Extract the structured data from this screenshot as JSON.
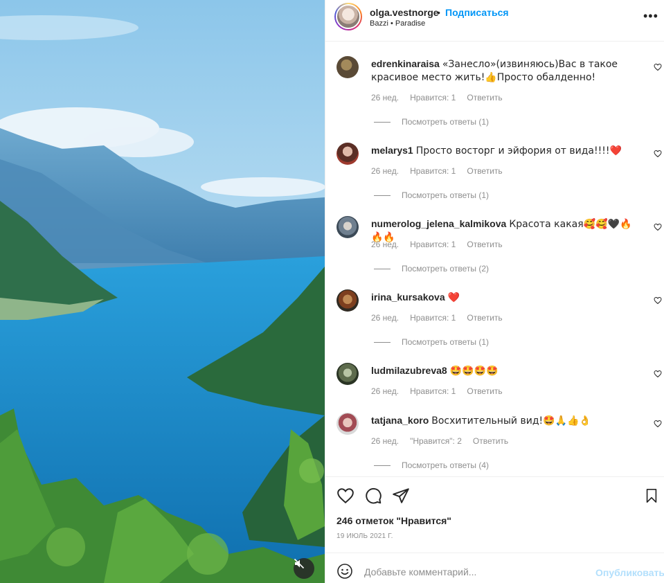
{
  "post": {
    "username": "olga.vestnorge",
    "separator": "•",
    "follow_label": "Подписаться",
    "subtitle": "Bazzi • Paradise",
    "more_icon": "more-horizontal-icon"
  },
  "comments": [
    {
      "user": "edrenkinaraisa",
      "text": "«Занесло»(извиняюсь)Вас в такое красивое место жить!👍Просто обалденно!",
      "age": "26 нед.",
      "likes": "Нравится: 1",
      "reply": "Ответить",
      "view_replies": "Посмотреть ответы (1)"
    },
    {
      "user": "melarys1",
      "text": "Просто восторг и эйфория от вида!!!!❤️",
      "age": "26 нед.",
      "likes": "Нравится: 1",
      "reply": "Ответить",
      "view_replies": "Посмотреть ответы (1)"
    },
    {
      "user": "numerolog_jelena_kalmikova",
      "text": "Красота какая🥰🥰🖤🔥🔥🔥",
      "age": "26 нед.",
      "likes": "Нравится: 1",
      "reply": "Ответить",
      "view_replies": "Посмотреть ответы (2)"
    },
    {
      "user": "irina_kursakova",
      "text": "❤️",
      "age": "26 нед.",
      "likes": "Нравится: 1",
      "reply": "Ответить",
      "view_replies": "Посмотреть ответы (1)"
    },
    {
      "user": "ludmilazubreva8",
      "text": "🤩🤩🤩🤩",
      "age": "26 нед.",
      "likes": "Нравится: 1",
      "reply": "Ответить",
      "view_replies": ""
    },
    {
      "user": "tatjana_koro",
      "text": "Восхитительный вид!🤩🙏👍👌",
      "age": "26 нед.",
      "likes": "\"Нравится\": 2",
      "reply": "Ответить",
      "view_replies": "Посмотреть ответы (4)"
    }
  ],
  "actions": {
    "likes_count": "246 отметок \"Нравится\"",
    "date": "19 ИЮЛЬ 2021 Г."
  },
  "composer": {
    "placeholder": "Добавьте комментарий...",
    "post_label": "Опубликовать"
  },
  "colors": {
    "accent": "#0095f6",
    "post_disabled": "#b2dffc",
    "muted": "#8e8e8e",
    "like_red": "#ed4956"
  }
}
